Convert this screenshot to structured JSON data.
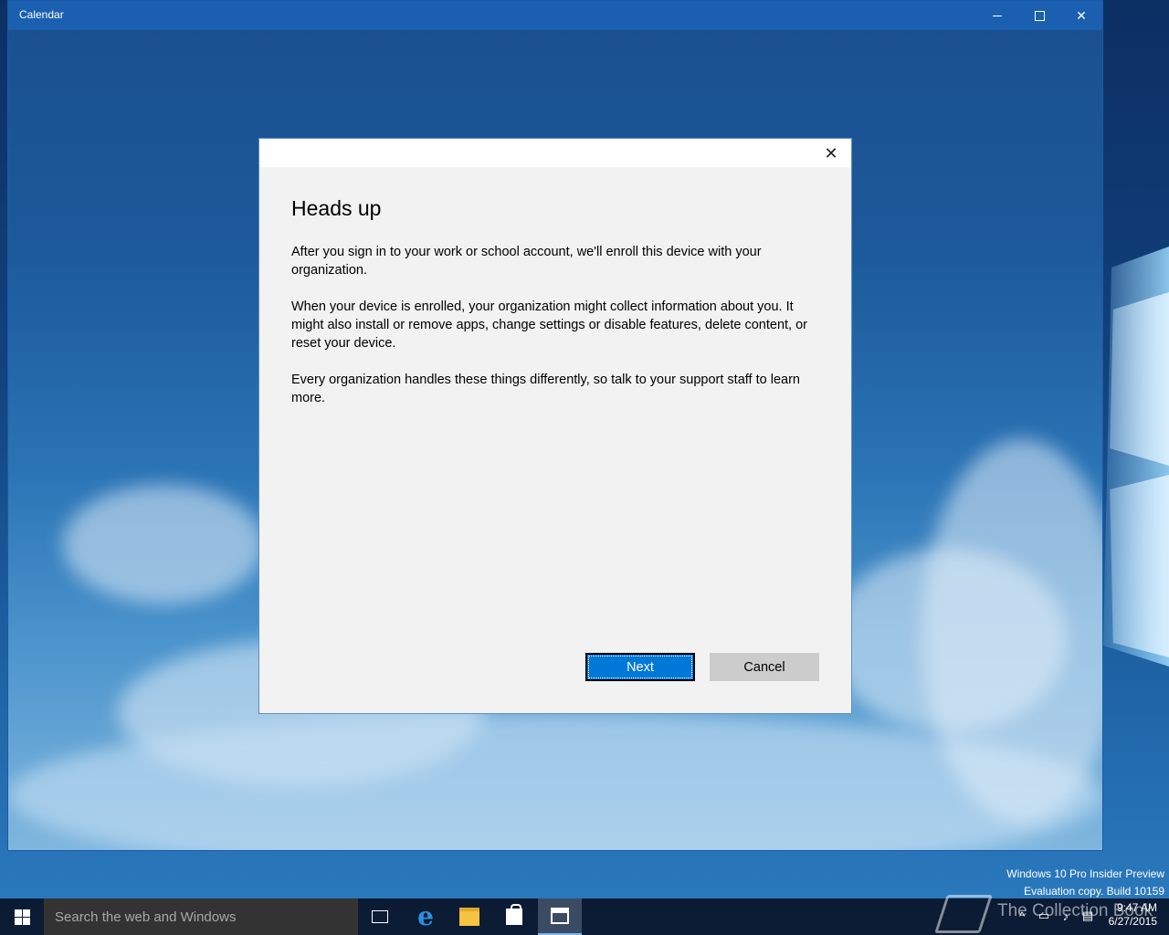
{
  "window": {
    "title": "Calendar",
    "minimize_icon": "minimize-icon",
    "maximize_icon": "maximize-icon",
    "close_icon": "close-icon"
  },
  "dialog": {
    "close_glyph": "✕",
    "title": "Heads up",
    "paragraphs": [
      "After you sign in to your work or school account, we'll enroll this device with your organization.",
      "When your device is enrolled, your organization might collect information about you. It might also install or remove apps, change settings or disable features, delete content, or reset your device.",
      "Every organization handles these things differently, so talk to your support staff to learn more."
    ],
    "next_label": "Next",
    "cancel_label": "Cancel"
  },
  "watermark": {
    "line1": "Windows 10 Pro Insider Preview",
    "line2": "Evaluation copy. Build 10159",
    "overlay_text": "The Collection Book"
  },
  "taskbar": {
    "search_placeholder": "Search the web and Windows",
    "apps": [
      "task-view",
      "edge",
      "file-explorer",
      "store",
      "calendar"
    ],
    "active_app": "calendar",
    "time": "9:47 AM",
    "date": "6/27/2015"
  },
  "colors": {
    "accent": "#0078d7",
    "titlebar": "#1a5fb0",
    "dialog_bg": "#f2f2f2",
    "taskbar": "#0a1428"
  }
}
